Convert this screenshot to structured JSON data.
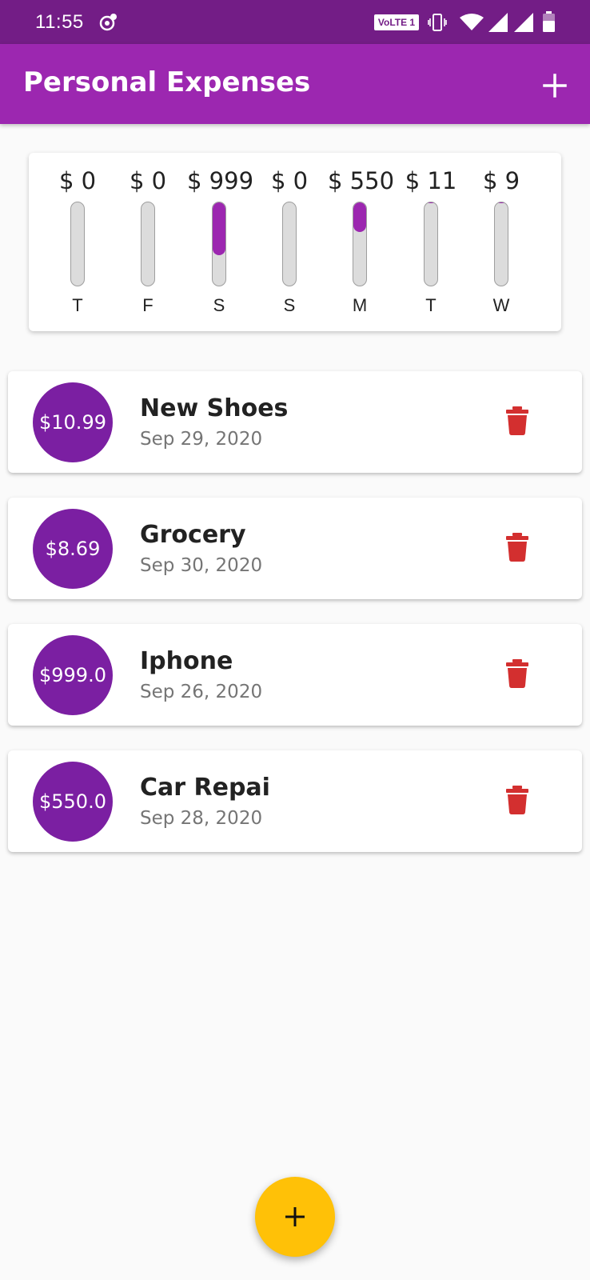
{
  "status_bar": {
    "time": "11:55",
    "volte_label": "VoLTE 1",
    "icons": [
      "app-notification-icon",
      "vibrate-icon",
      "wifi-icon",
      "signal-icon",
      "signal-icon",
      "battery-icon"
    ]
  },
  "app_bar": {
    "title": "Personal Expenses",
    "action_icon": "add-icon"
  },
  "chart": {
    "colors": {
      "fill": "#9c27b0",
      "track": "#dcdcdc"
    },
    "bars": [
      {
        "day": "T",
        "amount": "$ 0",
        "fraction": 0
      },
      {
        "day": "F",
        "amount": "$ 0",
        "fraction": 0
      },
      {
        "day": "S",
        "amount": "$ 999",
        "fraction": 0.638
      },
      {
        "day": "S",
        "amount": "$ 0",
        "fraction": 0
      },
      {
        "day": "M",
        "amount": "$ 550",
        "fraction": 0.351
      },
      {
        "day": "T",
        "amount": "$ 11",
        "fraction": 0.007
      },
      {
        "day": "W",
        "amount": "$ 9",
        "fraction": 0.006
      }
    ]
  },
  "transactions": [
    {
      "amount": "$10.99",
      "title": "New Shoes",
      "date": "Sep 29, 2020"
    },
    {
      "amount": "$8.69",
      "title": "Grocery",
      "date": "Sep 30, 2020"
    },
    {
      "amount": "$999.0",
      "title": "Iphone",
      "date": "Sep 26, 2020"
    },
    {
      "amount": "$550.0",
      "title": "Car Repai",
      "date": "Sep 28, 2020"
    }
  ],
  "colors": {
    "status_bar": "#731d86",
    "app_bar": "#9c27b0",
    "avatar": "#7b1fa2",
    "delete": "#d32f2f",
    "fab": "#ffc107"
  },
  "fab": {
    "icon": "add-icon"
  }
}
